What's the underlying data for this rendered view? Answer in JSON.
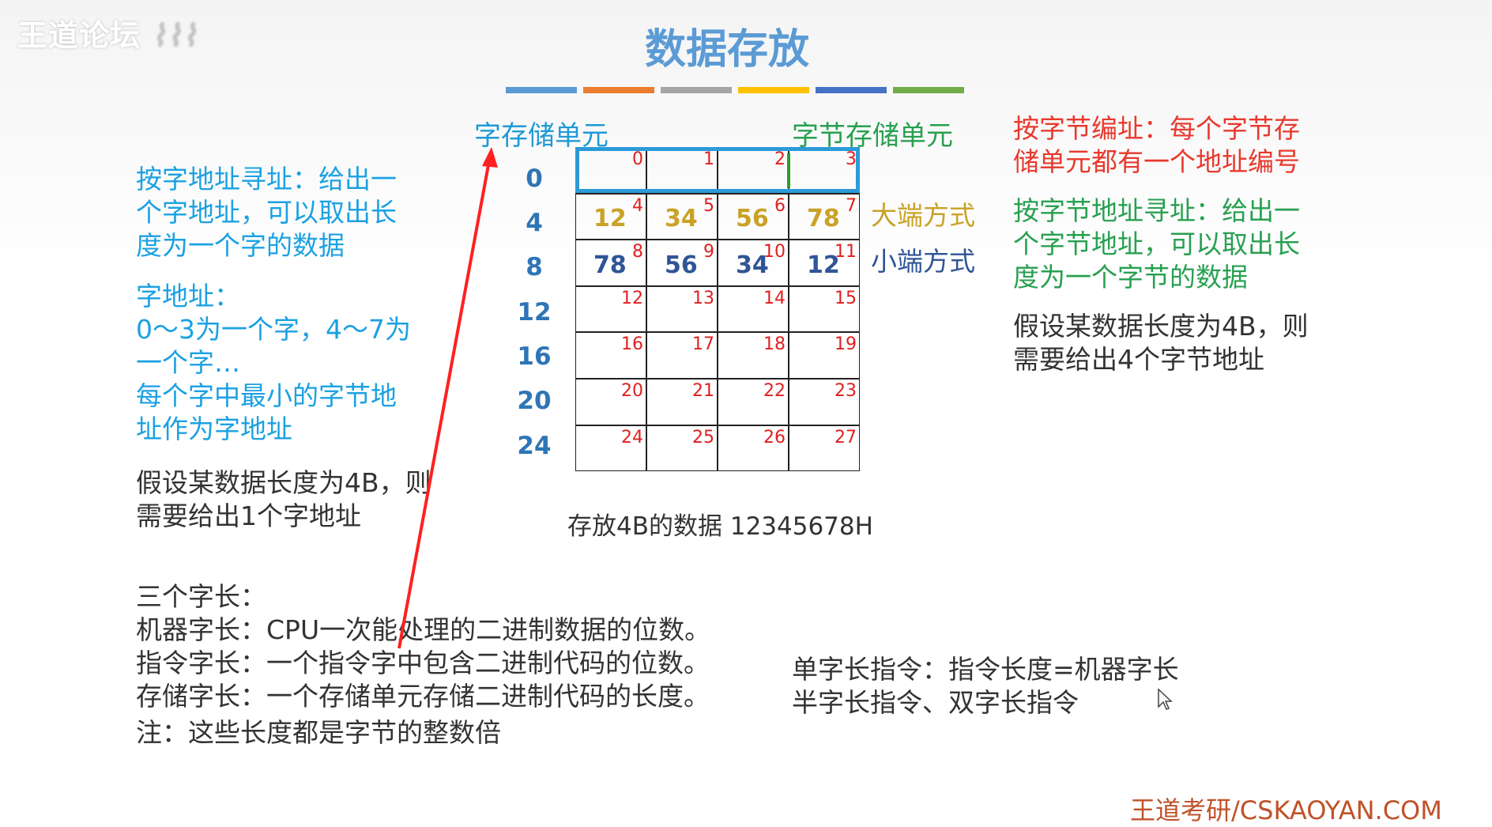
{
  "watermark": "王道论坛",
  "title": "数据存放",
  "colors": {
    "title": "#5b9bd5",
    "bars": [
      "#5b9bd5",
      "#ed7d31",
      "#a5a5a5",
      "#ffc000",
      "#4472c4",
      "#70ad47"
    ]
  },
  "headers": {
    "word_unit": "字存储单元",
    "byte_unit": "字节存储单元"
  },
  "word_addresses": [
    "0",
    "4",
    "8",
    "12",
    "16",
    "20",
    "24"
  ],
  "byte_numbers": [
    "0",
    "1",
    "2",
    "3",
    "4",
    "5",
    "6",
    "7",
    "8",
    "9",
    "10",
    "11",
    "12",
    "13",
    "14",
    "15",
    "16",
    "17",
    "18",
    "19",
    "20",
    "21",
    "22",
    "23",
    "24",
    "25",
    "26",
    "27"
  ],
  "big_endian": {
    "label": "大端方式",
    "values": [
      "12",
      "34",
      "56",
      "78"
    ],
    "color": "#c9a227"
  },
  "little_endian": {
    "label": "小端方式",
    "values": [
      "78",
      "56",
      "34",
      "12"
    ],
    "color": "#2f5597"
  },
  "caption": "存放4B的数据 12345678H",
  "left_text": {
    "word_addressing": [
      "按字地址寻址：给出一",
      "个字地址，可以取出长",
      "度为一个字的数据"
    ],
    "word_address": [
      "字地址：",
      "0～3为一个字，4～7为",
      "一个字…",
      "每个字中最小的字节地",
      "址作为字地址"
    ],
    "assume": [
      "假设某数据长度为4B，则",
      "需要给出1个字地址"
    ]
  },
  "right_text": {
    "byte_numbering": [
      "按字节编址：每个字节存",
      "储单元都有一个地址编号"
    ],
    "byte_addressing": [
      "按字节地址寻址：给出一",
      "个字节地址，可以取出长",
      "度为一个字节的数据"
    ],
    "assume": [
      "假设某数据长度为4B，则",
      "需要给出4个字节地址"
    ]
  },
  "word_lengths": {
    "title": "三个字长：",
    "lines": [
      "机器字长：CPU一次能处理的二进制数据的位数。",
      "指令字长：一个指令字中包含二进制代码的位数。",
      "存储字长：一个存储单元存储二进制代码的长度。"
    ],
    "note": "注：这些长度都是字节的整数倍"
  },
  "instruction_text": [
    "单字长指令：指令长度=机器字长",
    "半字长指令、双字长指令"
  ],
  "footer": "王道考研/CSKAOYAN.COM"
}
